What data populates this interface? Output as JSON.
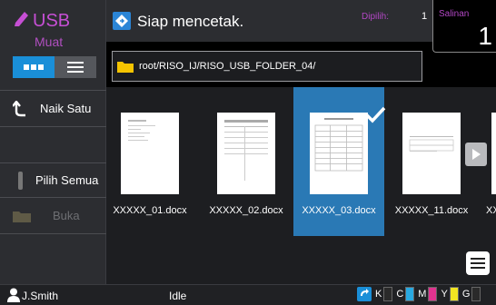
{
  "left_panel": {
    "title": "USB",
    "subtitle": "Muat",
    "up_label": "Naik Satu",
    "select_all_label": "Pilih Semua",
    "open_label": "Buka"
  },
  "status": {
    "text": "Siap mencetak.",
    "selected_label": "Dipilih:",
    "selected_value": "1",
    "copies_label": "Salinan",
    "copies_value": "1"
  },
  "path": {
    "value": "root/RISO_IJ/RISO_USB_FOLDER_04/"
  },
  "files": [
    {
      "name": "XXXXX_01.docx",
      "selected": false
    },
    {
      "name": "XXXXX_02.docx",
      "selected": false
    },
    {
      "name": "XXXXX_03.docx",
      "selected": true
    },
    {
      "name": "XXXXX_11.docx",
      "selected": false
    },
    {
      "name": "XX",
      "selected": false
    }
  ],
  "bottom_bar": {
    "user": "J.Smith",
    "status": "Idle",
    "inks": [
      {
        "label": "K",
        "color": "#2a2a2a"
      },
      {
        "label": "C",
        "color": "#29a9e1"
      },
      {
        "label": "M",
        "color": "#e0338f"
      },
      {
        "label": "Y",
        "color": "#f2e422"
      },
      {
        "label": "G",
        "color": "#2a2a2a"
      }
    ]
  },
  "colors": {
    "accent": "#1a8fd8",
    "purple": "#b247c4",
    "selected_tile": "#2a79b5"
  }
}
